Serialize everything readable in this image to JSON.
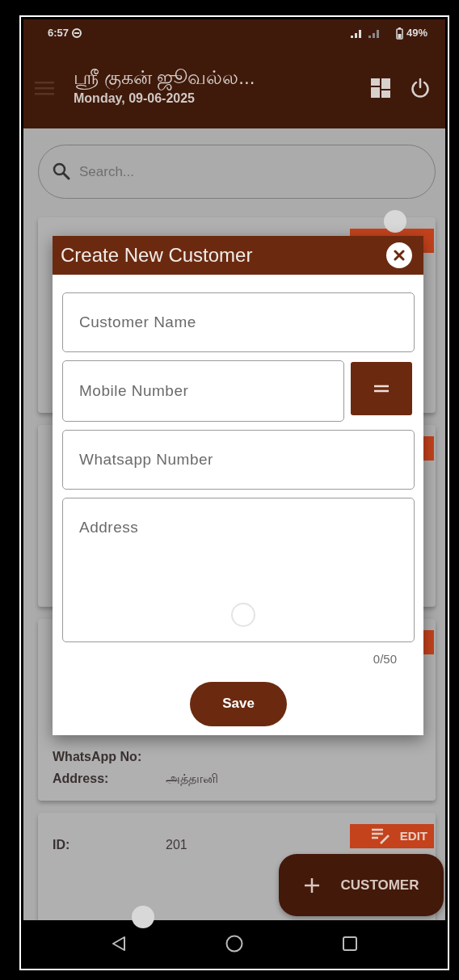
{
  "status_bar": {
    "time": "6:57",
    "battery": "49%"
  },
  "header": {
    "title": "ஸ்ரீ குகன் ஜூவல்ல...",
    "date": "Monday, 09-06-2025"
  },
  "search": {
    "placeholder": "Search..."
  },
  "cards": [
    {
      "kind": "covered"
    },
    {
      "kind": "covered"
    },
    {
      "kind": "covered",
      "rows": [
        {
          "label": "WhatsApp No:"
        },
        {
          "label": "Address:",
          "value": "அத்தானி"
        }
      ]
    },
    {
      "kind": "open",
      "rows": [
        {
          "label": "ID:",
          "value": "201"
        }
      ],
      "edit_label": "EDIT"
    }
  ],
  "dialog": {
    "title": "Create New Customer",
    "fields": [
      {
        "kind": "input",
        "placeholder": "Customer Name"
      },
      {
        "kind": "input_with_button",
        "placeholder": "Mobile Number"
      },
      {
        "kind": "input",
        "placeholder": "Whatsapp Number"
      },
      {
        "kind": "textarea",
        "placeholder": "Address",
        "counter": "0/50"
      }
    ],
    "save_label": "Save"
  },
  "fab": {
    "label": "CUSTOMER"
  }
}
